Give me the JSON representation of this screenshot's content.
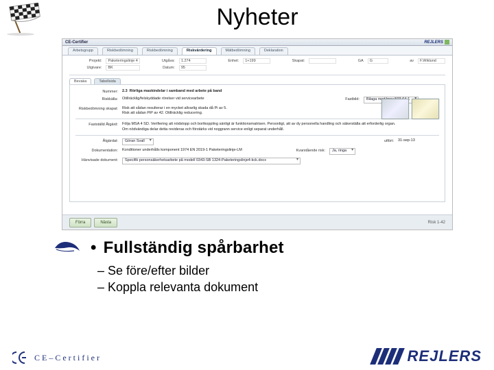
{
  "title": "Nyheter",
  "app": {
    "titlebar": "CE-Certifier",
    "brand": "REJLERS",
    "tabs": [
      "Arbetsgrupp",
      "Riskbedömning",
      "Riskbedömning",
      "Riskvärdering",
      "Mätbedömning",
      "Deklaration"
    ],
    "active_tab_index": 3,
    "meta": {
      "projekt_lbl": "Projekt:",
      "projekt_val": "Paketeringslinje 4",
      "utgava_lbl": "Utgåva:",
      "utgava_val": "1.274",
      "enhet_lbl": "Enhet:",
      "enhet_val": "1+199",
      "skapat_lbl": "Skapat:",
      "skapat_val": "",
      "ga_lbl": "GA",
      "ga_val": "G",
      "av_lbl": "av",
      "av_val": "F.Wiklund",
      "utgivare_lbl": "Utgivare:",
      "utgivare_val": "BK",
      "datum_lbl": "Datum:",
      "datum_val": "95"
    },
    "subtabs": [
      "Bevaka",
      "Tabellsida"
    ],
    "active_subtab_index": 0,
    "panel": {
      "nummer_lbl": "Nummer:",
      "nummer_val": "2.3",
      "nummer_desc": "Rörliga maskindelar i samband med arbete på band",
      "riskalla_lbl": "Riskkälla:",
      "riskalla_val": "Otillräcklig/felskyddade rörelser vid servicearbete",
      "riskbed_lbl": "Riskbedömning skapat:",
      "riskbed_val": "Risk att sådan resulterar i en mycket allvarlig skada då Pi av 5.",
      "riskbed_line2": "Risk att sådan PiP av 42. Otillräcklig reducering.",
      "fastst_lbl": "Fastställd Åtgärd:",
      "fastst_val": "Följa MSA 4 SD. Verifiering att nödstopp och bortkoppling sänligt är funktionsmatrisen. Personligt, att av dy personella handling och säkerställa att erforderlig organ.",
      "fastst_line2": "Om nödvändiga delar detta revideras och förstärks vid noggrann service enligt separat underhåll.",
      "fastbild_lbl": "Fastbild:",
      "fastbild_val": "Bilaga med brev 503-64-1",
      "atgardat_lbl": "Åtgärdat:",
      "atgardat_val": "Göran Svall",
      "utfort_lbl": "utfört:",
      "utfort_val": "31-sep-13",
      "dok_lbl": "Dokumentation:",
      "dok_val": "Konditioner underhålls komponent 1974 EN 2019-1 Paketeringslinje-LM",
      "kvar_lbl": "Kvarstående risk:",
      "kvar_val": "Ja, ringa",
      "hanvis_lbl": "Hänvisade dokument:",
      "hanvis_val": "Specifik personsäkerhetsarbete på modell 0343-SB 1324-Paketeringslinje4-kck.docx"
    },
    "footer": {
      "btn_prev": "Förra",
      "btn_next": "Nästa",
      "pager": "Risk 1-42"
    }
  },
  "bullets": {
    "main": "Fullständig spårbarhet",
    "subs": [
      "Se före/efter bilder",
      "Koppla relevanta dokument"
    ]
  },
  "footer_logos": {
    "ce": "C E – C e r t i f i e r",
    "rejlers": "REJLERS"
  }
}
